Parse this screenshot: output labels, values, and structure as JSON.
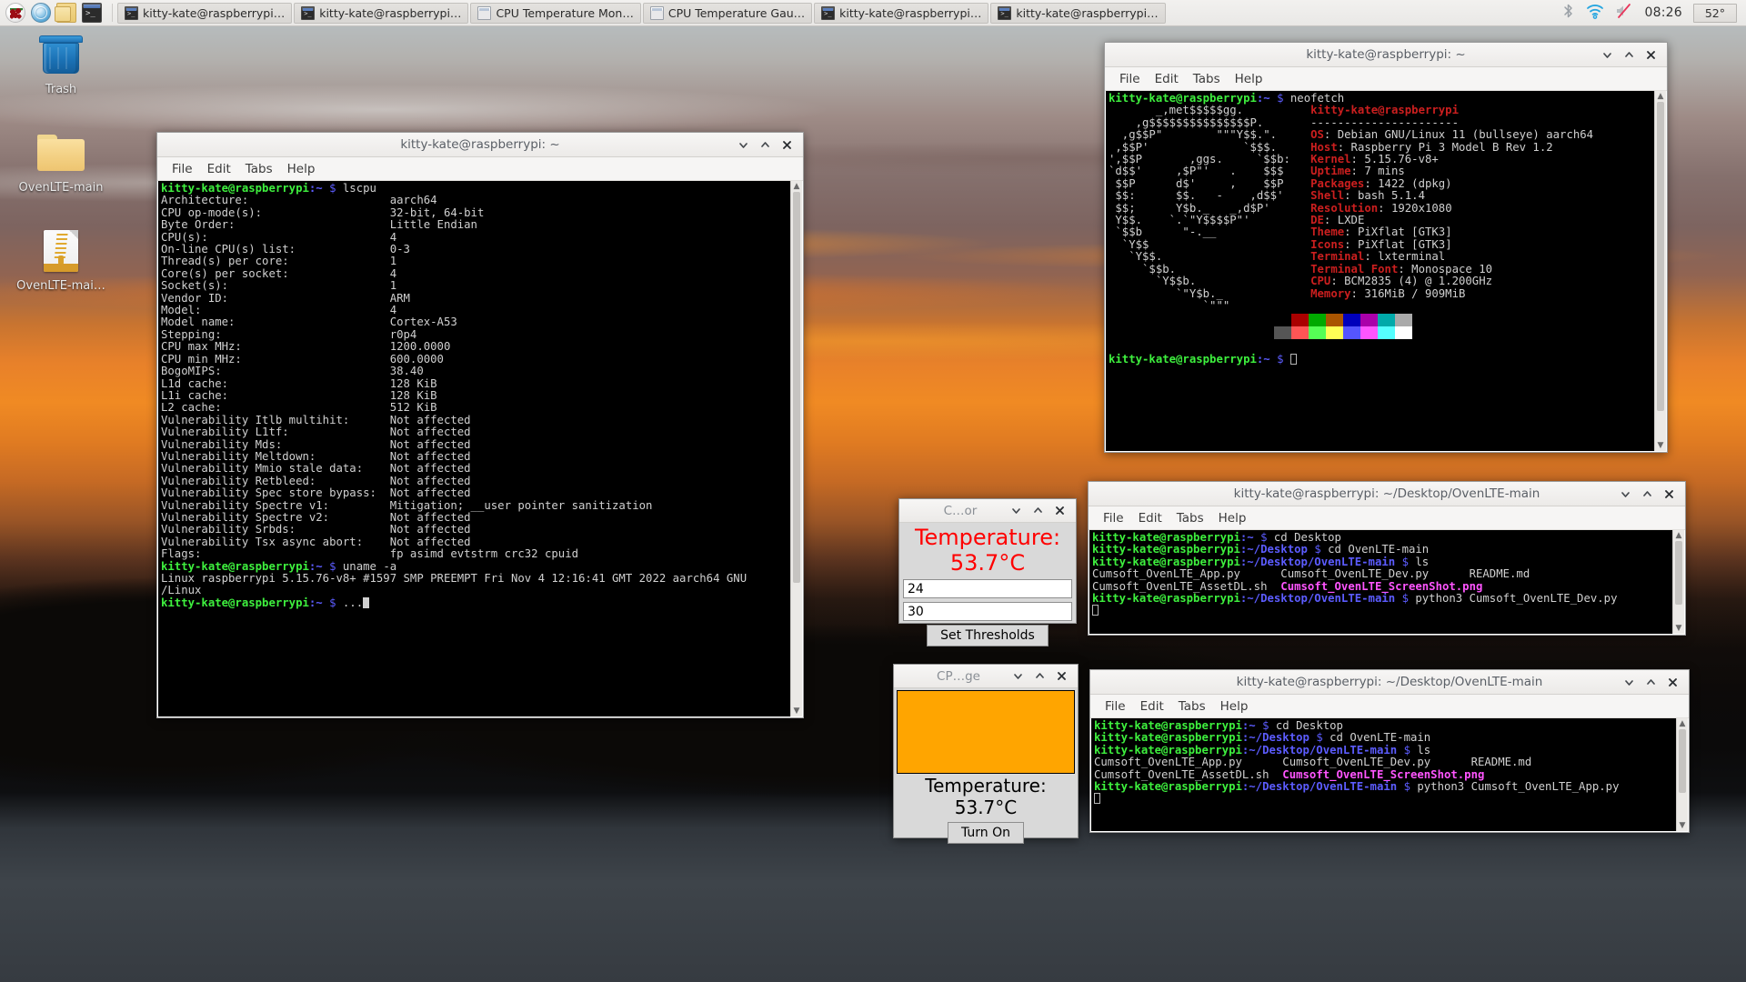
{
  "taskbar": {
    "launchers": [
      {
        "name": "raspberry-menu-icon",
        "icon": "raspberry-icon"
      },
      {
        "name": "web-browser-launcher",
        "icon": "globe-icon"
      },
      {
        "name": "file-manager-launcher",
        "icon": "folders-icon"
      },
      {
        "name": "terminal-launcher",
        "icon": "terminal-icon"
      }
    ],
    "tasks": [
      {
        "label": "kitty-kate@raspberrypi…",
        "icon": "terminal-icon"
      },
      {
        "label": "kitty-kate@raspberrypi…",
        "icon": "terminal-icon"
      },
      {
        "label": "CPU Temperature Mon…",
        "icon": "window-icon"
      },
      {
        "label": "CPU Temperature Gau…",
        "icon": "window-icon"
      },
      {
        "label": "kitty-kate@raspberrypi…",
        "icon": "terminal-icon"
      },
      {
        "label": "kitty-kate@raspberrypi…",
        "icon": "terminal-icon"
      }
    ],
    "tray": {
      "bluetooth": "bluetooth-icon",
      "wifi": "wifi-icon",
      "volume_muted": "volume-muted-icon",
      "clock": "08:26",
      "cpu_temp": "52°"
    }
  },
  "desktop": {
    "icons": [
      {
        "label": "Trash",
        "type": "trash"
      },
      {
        "label": "OvenLTE-main",
        "type": "folder"
      },
      {
        "label": "OvenLTE-mai…",
        "type": "archive"
      }
    ]
  },
  "menu": {
    "file": "File",
    "edit": "Edit",
    "tabs": "Tabs",
    "help": "Help"
  },
  "window_lscpu": {
    "title": "kitty-kate@raspberrypi: ~",
    "prompt_user": "kitty-kate@raspberrypi",
    "prompt_path": ":~",
    "prompt_sym": "$",
    "cmd1": "lscpu",
    "cmd2": "uname -a",
    "cmd3": "...",
    "rows": [
      [
        "Architecture:",
        "aarch64"
      ],
      [
        "CPU op-mode(s):",
        "32-bit, 64-bit"
      ],
      [
        "Byte Order:",
        "Little Endian"
      ],
      [
        "CPU(s):",
        "4"
      ],
      [
        "On-line CPU(s) list:",
        "0-3"
      ],
      [
        "Thread(s) per core:",
        "1"
      ],
      [
        "Core(s) per socket:",
        "4"
      ],
      [
        "Socket(s):",
        "1"
      ],
      [
        "Vendor ID:",
        "ARM"
      ],
      [
        "Model:",
        "4"
      ],
      [
        "Model name:",
        "Cortex-A53"
      ],
      [
        "Stepping:",
        "r0p4"
      ],
      [
        "CPU max MHz:",
        "1200.0000"
      ],
      [
        "CPU min MHz:",
        "600.0000"
      ],
      [
        "BogoMIPS:",
        "38.40"
      ],
      [
        "L1d cache:",
        "128 KiB"
      ],
      [
        "L1i cache:",
        "128 KiB"
      ],
      [
        "L2 cache:",
        "512 KiB"
      ],
      [
        "Vulnerability Itlb multihit:",
        "Not affected"
      ],
      [
        "Vulnerability L1tf:",
        "Not affected"
      ],
      [
        "Vulnerability Mds:",
        "Not affected"
      ],
      [
        "Vulnerability Meltdown:",
        "Not affected"
      ],
      [
        "Vulnerability Mmio stale data:",
        "Not affected"
      ],
      [
        "Vulnerability Retbleed:",
        "Not affected"
      ],
      [
        "Vulnerability Spec store bypass:",
        "Not affected"
      ],
      [
        "Vulnerability Spectre v1:",
        "Mitigation; __user pointer sanitization"
      ],
      [
        "Vulnerability Spectre v2:",
        "Not affected"
      ],
      [
        "Vulnerability Srbds:",
        "Not affected"
      ],
      [
        "Vulnerability Tsx async abort:",
        "Not affected"
      ],
      [
        "Flags:",
        "fp asimd evtstrm crc32 cpuid"
      ]
    ],
    "uname_out1": "Linux raspberrypi 5.15.76-v8+ #1597 SMP PREEMPT Fri Nov 4 12:16:41 GMT 2022 aarch64 GNU",
    "uname_out2": "/Linux"
  },
  "window_neofetch": {
    "title": "kitty-kate@raspberrypi: ~",
    "cmd": "neofetch",
    "ascii": [
      "       _,met$$$$$gg.",
      "    ,g$$$$$$$$$$$$$$$P.",
      "  ,g$$P\"        \"\"\"Y$$.\".",
      " ,$$P'              `$$$.",
      "',$$P       ,ggs.     `$$b:",
      "`d$$'     ,$P\"'   .    $$$",
      " $$P      d$'     ,    $$P",
      " $$:      $$.   -    ,d$$'",
      " $$;      Y$b._   _,d$P'",
      " Y$$.    `.`\"Y$$$$P\"'",
      " `$$b      \"-.__",
      "  `Y$$",
      "   `Y$$.",
      "     `$$b.",
      "       `Y$$b.",
      "          `\"Y$b._",
      "              `\"\"\""
    ],
    "header_user": "kitty-kate@raspberrypi",
    "header_rule": "----------------------",
    "info": [
      {
        "key": "OS",
        "value": "Debian GNU/Linux 11 (bullseye) aarch64"
      },
      {
        "key": "Host",
        "value": "Raspberry Pi 3 Model B Rev 1.2"
      },
      {
        "key": "Kernel",
        "value": "5.15.76-v8+"
      },
      {
        "key": "Uptime",
        "value": "7 mins"
      },
      {
        "key": "Packages",
        "value": "1422 (dpkg)"
      },
      {
        "key": "Shell",
        "value": "bash 5.1.4"
      },
      {
        "key": "Resolution",
        "value": "1920x1080"
      },
      {
        "key": "DE",
        "value": "LXDE"
      },
      {
        "key": "Theme",
        "value": "PiXflat [GTK3]"
      },
      {
        "key": "Icons",
        "value": "PiXflat [GTK3]"
      },
      {
        "key": "Terminal",
        "value": "lxterminal"
      },
      {
        "key": "Terminal Font",
        "value": "Monospace 10"
      },
      {
        "key": "CPU",
        "value": "BCM2835 (4) @ 1.200GHz"
      },
      {
        "key": "Memory",
        "value": "316MiB / 909MiB"
      }
    ],
    "palette_row1": [
      "#000000",
      "#aa0000",
      "#00aa00",
      "#aa5500",
      "#0000bb",
      "#aa00aa",
      "#00aaaa",
      "#aaaaaa"
    ],
    "palette_row2": [
      "#555555",
      "#ff5555",
      "#55ff55",
      "#ffff55",
      "#5555ff",
      "#ff55ff",
      "#55ffff",
      "#ffffff"
    ]
  },
  "window_oven_dev": {
    "title": "kitty-kate@raspberrypi: ~/Desktop/OvenLTE-main",
    "lines": [
      {
        "user": "kitty-kate@raspberrypi",
        "path": ":~",
        "sym": "$",
        "cmd": "cd Desktop"
      },
      {
        "user": "kitty-kate@raspberrypi",
        "path": ":~/Desktop",
        "sym": "$",
        "cmd": "cd OvenLTE-main"
      },
      {
        "user": "kitty-kate@raspberrypi",
        "path": ":~/Desktop/OvenLTE-main",
        "sym": "$",
        "cmd": "ls"
      }
    ],
    "ls_row1_a": "Cumsoft_OvenLTE_App.py",
    "ls_row1_b": "Cumsoft_OvenLTE_Dev.py",
    "ls_row1_c": "README.md",
    "ls_row2_a": "Cumsoft_OvenLTE_AssetDL.sh",
    "ls_row2_b": "Cumsoft_OvenLTE_ScreenShot.png",
    "last_cmd": "python3 Cumsoft_OvenLTE_Dev.py"
  },
  "window_oven_app": {
    "title": "kitty-kate@raspberrypi: ~/Desktop/OvenLTE-main",
    "lines": [
      {
        "user": "kitty-kate@raspberrypi",
        "path": ":~",
        "sym": "$",
        "cmd": "cd Desktop"
      },
      {
        "user": "kitty-kate@raspberrypi",
        "path": ":~/Desktop",
        "sym": "$",
        "cmd": "cd OvenLTE-main"
      },
      {
        "user": "kitty-kate@raspberrypi",
        "path": ":~/Desktop/OvenLTE-main",
        "sym": "$",
        "cmd": "ls"
      }
    ],
    "ls_row1_a": "Cumsoft_OvenLTE_App.py",
    "ls_row1_b": "Cumsoft_OvenLTE_Dev.py",
    "ls_row1_c": "README.md",
    "ls_row2_a": "Cumsoft_OvenLTE_AssetDL.sh",
    "ls_row2_b": "Cumsoft_OvenLTE_ScreenShot.png",
    "last_cmd": "python3 Cumsoft_OvenLTE_App.py"
  },
  "monitor_app": {
    "title": "C…or",
    "full_title": "CPU Temperature Monitor",
    "temperature_label": "Temperature: 53.7°C",
    "low_threshold": "24",
    "high_threshold": "30",
    "set_button": "Set Thresholds",
    "temp_color": "#ff0000"
  },
  "gauge_app": {
    "title": "CP…ge",
    "full_title": "CPU Temperature Gauge",
    "gauge_color": "#ffa500",
    "temperature_label": "Temperature: 53.7°C",
    "toggle_button": "Turn On"
  }
}
